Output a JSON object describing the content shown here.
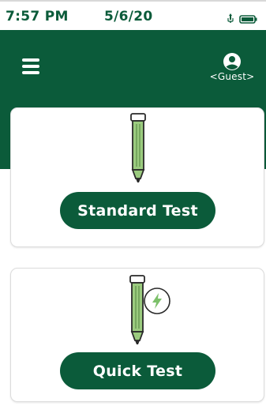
{
  "status_bar": {
    "time": "7:57 PM",
    "date": "5/6/20",
    "icons": [
      "usb-icon",
      "battery-icon"
    ]
  },
  "header": {
    "menu_icon": "hamburger-menu-icon",
    "user_icon": "user-account-icon",
    "user_label": "<Guest>"
  },
  "cards": {
    "standard": {
      "icon": "pipette-icon",
      "button_label": "Standard Test"
    },
    "quick": {
      "icon": "pipette-icon",
      "badge_icon": "lightning-bolt-icon",
      "button_label": "Quick Test"
    }
  },
  "colors": {
    "brand_green": "#0b5b3a",
    "pipette_fill": "#9bcb7f",
    "bolt_color": "#7cc06a",
    "background": "#ffffff"
  }
}
